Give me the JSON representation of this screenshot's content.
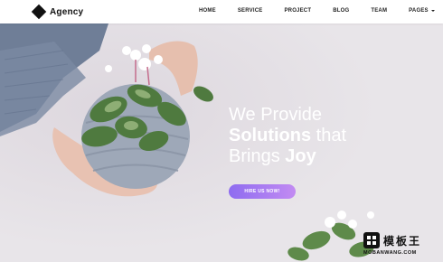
{
  "nav": {
    "brand": "Agency",
    "items": [
      {
        "label": "HOME"
      },
      {
        "label": "SERVICE"
      },
      {
        "label": "PROJECT"
      },
      {
        "label": "BLOG"
      },
      {
        "label": "TEAM"
      },
      {
        "label": "PAGES"
      }
    ],
    "pages_icon": "chevron-down-icon"
  },
  "hero": {
    "line1": "We Provide",
    "line2_bold": "Solutions",
    "line2_rest": "that",
    "line3_rest": "Brings",
    "line3_bold": "Joy",
    "cta_label": "HIRE US NOW!",
    "cta_gradient": [
      "#8e6cf0",
      "#c28bf2"
    ]
  },
  "watermark": {
    "name": "模板王",
    "url": "MOBANWANG.COM"
  }
}
